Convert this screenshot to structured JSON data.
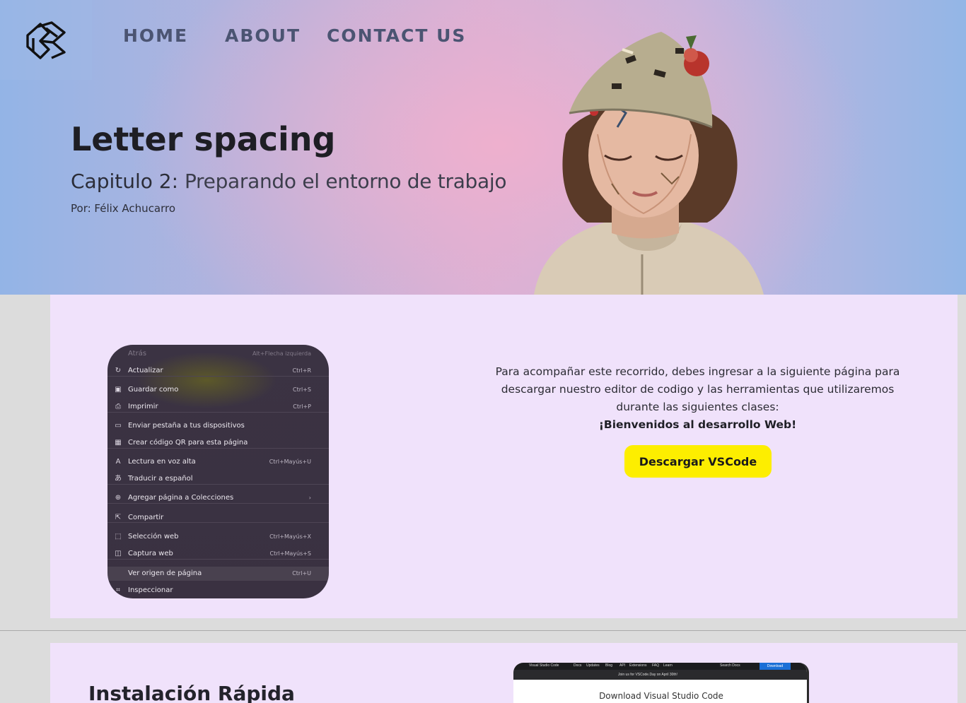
{
  "nav": {
    "items": [
      "HOME",
      "ABOUT",
      "CONTACT US"
    ],
    "logo_icon": "geometric-logo-icon"
  },
  "hero": {
    "title": "Letter spacing",
    "subtitle_prefix": "Capitulo 2:",
    "subtitle_rest": "Preparando el entorno de trabajo",
    "author": "Por: Félix Achucarro"
  },
  "context_menu": {
    "items": [
      {
        "label": "Atrás",
        "shortcut": "Alt+Flecha izquierda",
        "icon": "",
        "dim": true
      },
      {
        "label": "Actualizar",
        "shortcut": "Ctrl+R",
        "icon": "refresh-icon"
      },
      {
        "label": "Guardar como",
        "shortcut": "Ctrl+S",
        "icon": "save-icon"
      },
      {
        "label": "Imprimir",
        "shortcut": "Ctrl+P",
        "icon": "print-icon"
      },
      {
        "label": "Enviar pestaña a tus dispositivos",
        "shortcut": "",
        "icon": "devices-icon"
      },
      {
        "label": "Crear código QR para esta página",
        "shortcut": "",
        "icon": "qr-icon"
      },
      {
        "label": "Lectura en voz alta",
        "shortcut": "Ctrl+Mayús+U",
        "icon": "read-aloud-icon"
      },
      {
        "label": "Traducir a español",
        "shortcut": "",
        "icon": "translate-icon"
      },
      {
        "label": "Agregar página a Colecciones",
        "shortcut": "›",
        "icon": "collections-icon"
      },
      {
        "label": "Compartir",
        "shortcut": "",
        "icon": "share-icon"
      },
      {
        "label": "Selección web",
        "shortcut": "Ctrl+Mayús+X",
        "icon": "web-select-icon"
      },
      {
        "label": "Captura web",
        "shortcut": "Ctrl+Mayús+S",
        "icon": "web-capture-icon"
      },
      {
        "label": "Ver origen de página",
        "shortcut": "Ctrl+U",
        "icon": ""
      },
      {
        "label": "Inspeccionar",
        "shortcut": "",
        "icon": "inspect-icon"
      }
    ]
  },
  "section1": {
    "line1": "Para acompañar este recorrido, debes ingresar a la siguiente página para",
    "line2": "descargar nuestro editor de codigo y las herramientas que utilizaremos",
    "line3": "durante las siguientes clases:",
    "bold": "¡Bienvenidos al desarrollo Web!",
    "button": "Descargar VSCode",
    "button_color": "#fdee00"
  },
  "section2": {
    "title": "Instalación Rápida",
    "shot_nav": [
      "Visual Studio Code",
      "Docs",
      "Updates",
      "Blog",
      "API",
      "Extensions",
      "FAQ",
      "Learn"
    ],
    "shot_search": "Search Docs",
    "shot_download": "Download",
    "shot_banner": "Join us for VSCode.Day on April 30th!",
    "shot_heading": "Download Visual Studio Code"
  },
  "colors": {
    "section_bg": "#f0e2fb",
    "nav_text": "#4b5472",
    "menu_bg": "#3b3343"
  }
}
